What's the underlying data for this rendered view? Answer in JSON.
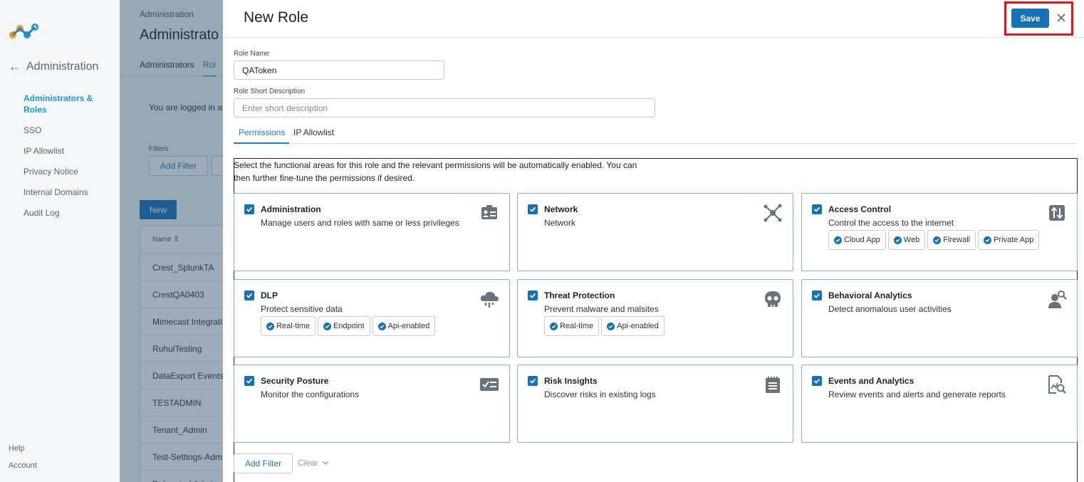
{
  "nav": {
    "back_label": "Administration",
    "items": [
      {
        "label": "Administrators & Roles",
        "active": true
      },
      {
        "label": "SSO"
      },
      {
        "label": "IP Allowlist"
      },
      {
        "label": "Privacy Notice"
      },
      {
        "label": "Internal Domains"
      },
      {
        "label": "Audit Log"
      }
    ],
    "help": "Help",
    "account": "Account"
  },
  "background": {
    "breadcrumb": "Administration",
    "title": "Administrato",
    "tabs": [
      "Administrators",
      "Rol"
    ],
    "logged_in": "You are logged in as",
    "filters_label": "Filters",
    "add_filter": "Add Filter",
    "new_button": "New",
    "table_header": "Name",
    "rows": [
      "Crest_SplunkTA",
      "CrestQA0403",
      "Mimecast Integrati",
      "RuhulTesting",
      "DataExport Events",
      "TESTADMIN",
      "Tenant_Admin",
      "Test-Settings-Adm",
      "Delegated Admin"
    ]
  },
  "panel": {
    "title": "New Role",
    "save": "Save",
    "role_name_label": "Role Name",
    "role_name_value": "QAToken",
    "short_desc_label": "Role Short Description",
    "short_desc_placeholder": "Enter short description",
    "tabs": [
      "Permissions",
      "IP Allowlist"
    ],
    "intro_line1": "Select the functional areas for this role and the relevant permissions will be automatically enabled. You can",
    "intro_line2": "then further fine-tune the permissions if desired.",
    "cards": [
      {
        "title": "Administration",
        "desc": "Manage users and roles with same or less privileges",
        "icon": "id-card-icon",
        "chips": []
      },
      {
        "title": "Network",
        "desc": "Network",
        "icon": "network-hub-icon",
        "chips": []
      },
      {
        "title": "Access Control",
        "desc": "Control the access to the internet",
        "icon": "up-down-arrows-icon",
        "chips": [
          "Cloud App",
          "Web",
          "Firewall",
          "Private App"
        ]
      },
      {
        "title": "DLP",
        "desc": "Protect sensitive data",
        "icon": "cloud-drip-icon",
        "chips": [
          "Real-time",
          "Endpoint",
          "Api-enabled"
        ]
      },
      {
        "title": "Threat Protection",
        "desc": "Prevent malware and malsites",
        "icon": "skull-icon",
        "chips": [
          "Real-time",
          "Api-enabled"
        ]
      },
      {
        "title": "Behavioral Analytics",
        "desc": "Detect anomalous user activities",
        "icon": "user-search-icon",
        "chips": []
      },
      {
        "title": "Security Posture",
        "desc": "Monitor the configurations",
        "icon": "checklist-icon",
        "chips": []
      },
      {
        "title": "Risk Insights",
        "desc": "Discover risks in existing logs",
        "icon": "notepad-icon",
        "chips": []
      },
      {
        "title": "Events and Analytics",
        "desc": "Review events and alerts and generate reports",
        "icon": "report-search-icon",
        "chips": []
      }
    ],
    "add_filter": "Add Filter",
    "clear": "Clear"
  },
  "colors": {
    "accent": "#1672b8",
    "link": "#1b80c0",
    "highlight": "#e0161e"
  }
}
